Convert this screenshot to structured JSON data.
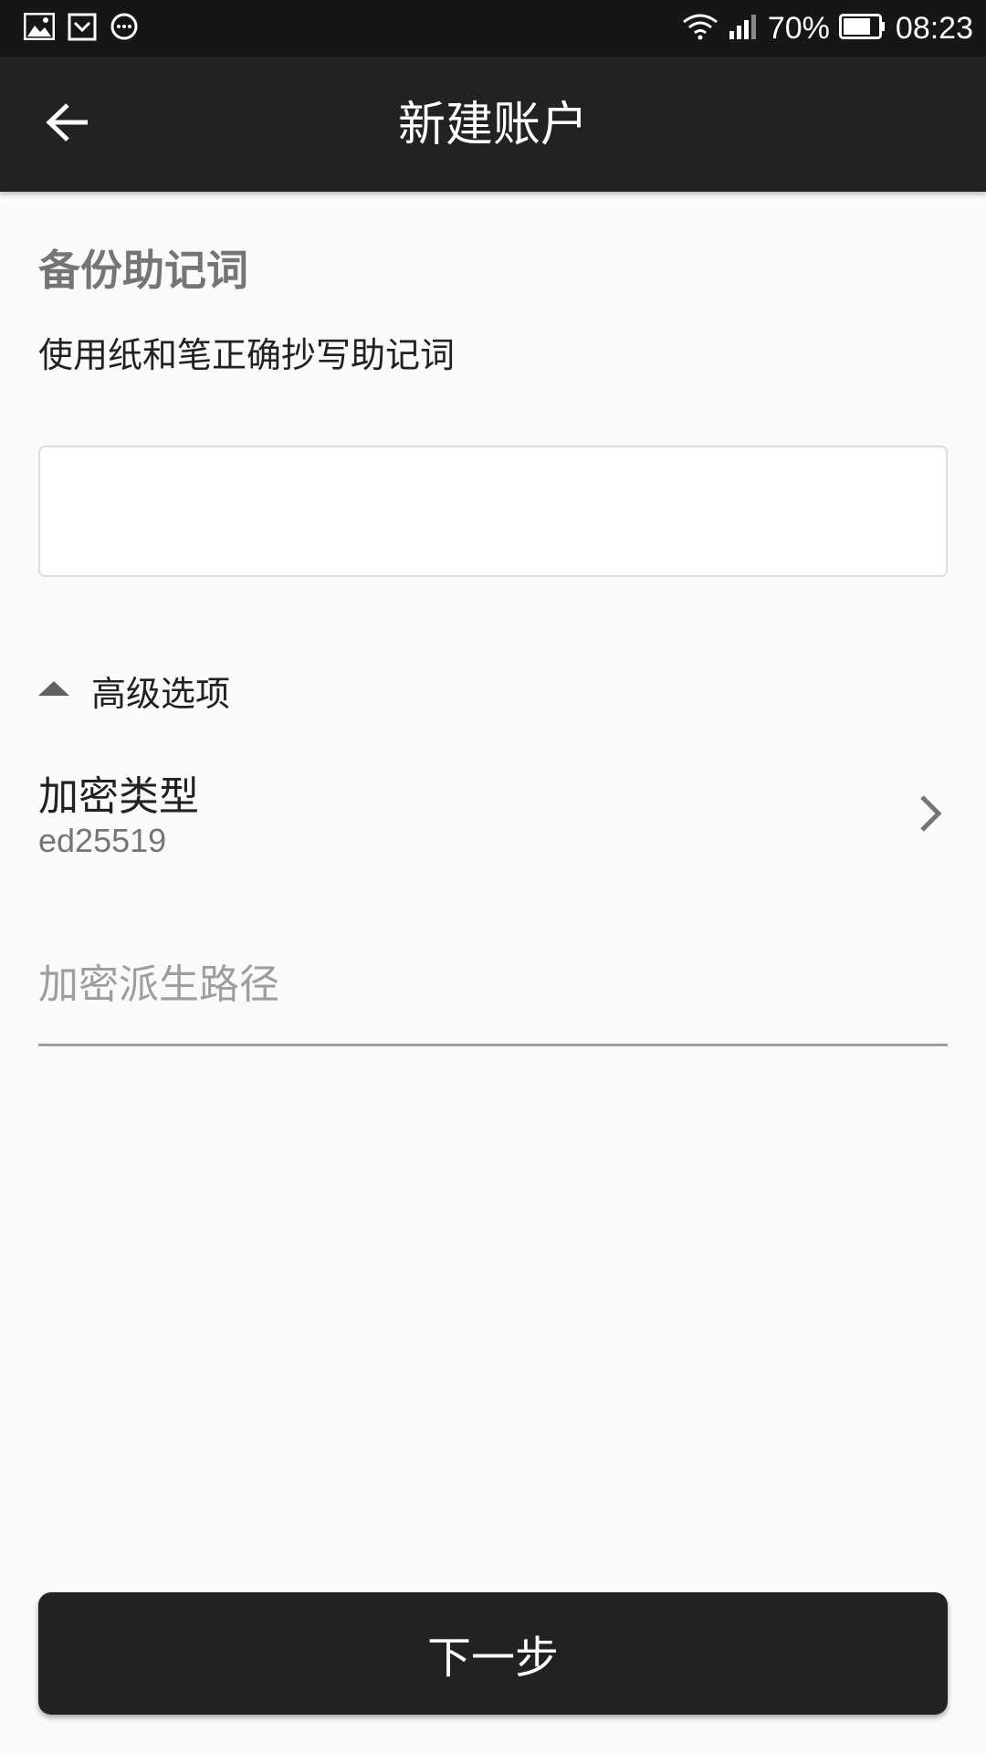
{
  "status_bar": {
    "battery_text": "70%",
    "time": "08:23",
    "icons": [
      "image-icon",
      "calendar-icon",
      "message-icon",
      "wifi-icon",
      "signal-icon",
      "battery-icon"
    ]
  },
  "app_bar": {
    "title": "新建账户",
    "back_icon": "arrow-left-icon"
  },
  "backup": {
    "title": "备份助记词",
    "description": "使用纸和笔正确抄写助记词",
    "mnemonic_value": ""
  },
  "advanced": {
    "label": "高级选项",
    "toggle_icon": "triangle-up-icon",
    "encryption_type_label": "加密类型",
    "encryption_type_value": "ed25519",
    "derivation_path_placeholder": "加密派生路径"
  },
  "footer": {
    "next_label": "下一步"
  },
  "colors": {
    "status_bar_bg": "#161616",
    "app_bar_bg": "#222222",
    "page_bg": "#fafafa",
    "button_bg": "#222222"
  }
}
